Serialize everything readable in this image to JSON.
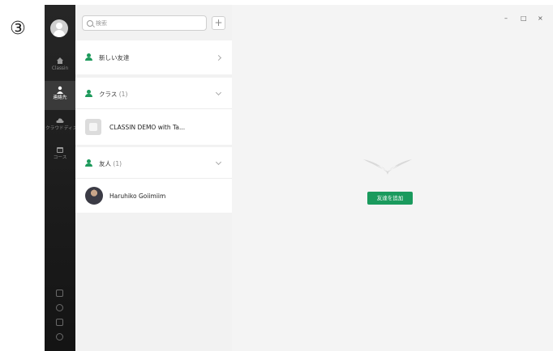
{
  "step_marker": "③",
  "sidebar": {
    "items": [
      {
        "label": "Classin",
        "icon": "home-icon"
      },
      {
        "label": "連絡先",
        "icon": "contacts-icon"
      },
      {
        "label": "クラウドディスク",
        "icon": "cloud-icon"
      },
      {
        "label": "コース",
        "icon": "calendar-icon"
      }
    ],
    "bottom_icons": [
      "sign-out-icon",
      "question-icon",
      "message-icon",
      "settings-icon"
    ]
  },
  "search": {
    "placeholder": "検索",
    "add_label": "+"
  },
  "list": {
    "new_friends": {
      "label": "新しい友達"
    },
    "classes": {
      "label": "クラス",
      "count": "(1)",
      "items": [
        {
          "name": "CLASSIN DEMO with Ta..."
        }
      ]
    },
    "friends": {
      "label": "友人",
      "count": "(1)",
      "items": [
        {
          "name": "Haruhiko Goiimiim"
        }
      ]
    }
  },
  "main": {
    "add_friend_button": "友達を追加",
    "window_controls": {
      "minimize": "–",
      "maximize": "□",
      "close": "×"
    }
  },
  "colors": {
    "accent": "#1a9a5d",
    "sidebar_bg": "#1c1c1c",
    "panel_bg": "#f2f2f2"
  }
}
